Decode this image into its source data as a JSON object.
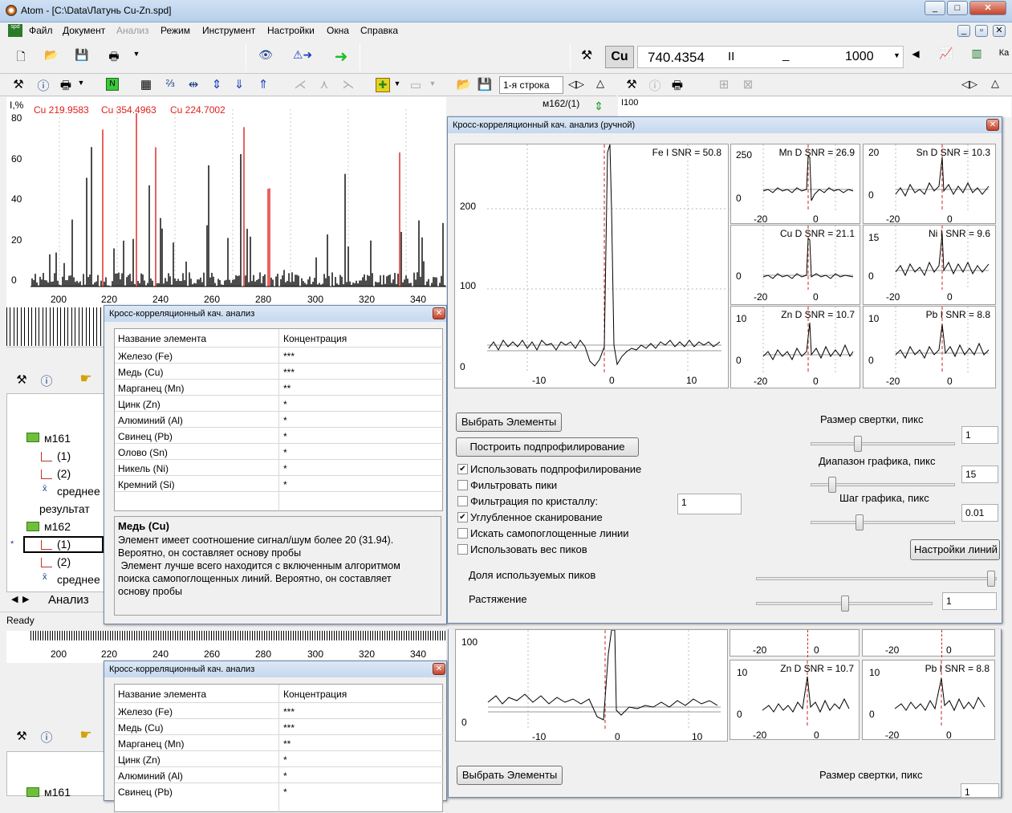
{
  "window": {
    "title": "Atom - [C:\\Data\\Латунь Cu-Zn.spd]"
  },
  "menu": [
    "Файл",
    "Документ",
    "Анализ",
    "Режим",
    "Инструмент",
    "Настройки",
    "Окна",
    "Справка"
  ],
  "top_toolbar": {
    "element": "Cu",
    "wavelength": "740.4354",
    "marker_a": "II",
    "marker_b": "_",
    "count": "1000"
  },
  "spectrum_toolbar": {
    "row_select": "1-я строка"
  },
  "spectrum": {
    "y_unit": "I,%",
    "peaks_labels": [
      "Cu 219.9583",
      "Cu 354.4963",
      "Cu 224.7002"
    ],
    "y_ticks": [
      "80",
      "60",
      "40",
      "20",
      "0"
    ],
    "x_ticks": [
      "200",
      "220",
      "240",
      "260",
      "280",
      "300",
      "320",
      "340"
    ],
    "file_tag": "м162/(1)"
  },
  "right_panel": {
    "tag": "I100"
  },
  "tree": {
    "items": [
      {
        "label": "м161",
        "kind": "folder"
      },
      {
        "label": "(1)",
        "kind": "chart"
      },
      {
        "label": "(2)",
        "kind": "chart"
      },
      {
        "label": "среднее",
        "kind": "avg"
      },
      {
        "label": "результат",
        "kind": "text"
      },
      {
        "label": "м162",
        "kind": "folder"
      },
      {
        "label": "(1)",
        "kind": "chart"
      },
      {
        "label": "(2)",
        "kind": "chart"
      },
      {
        "label": "среднее",
        "kind": "avg"
      }
    ],
    "current_marker": "*",
    "tab": "Анализ"
  },
  "status": "Ready",
  "dlg_small": {
    "title": "Кросс-корреляционный кач. анализ",
    "col_name": "Название элемента",
    "col_conc": "Концентрация",
    "rows": [
      [
        "Железо (Fe)",
        "***"
      ],
      [
        "Медь (Cu)",
        "***"
      ],
      [
        "Марганец (Mn)",
        "**"
      ],
      [
        "Цинк (Zn)",
        "*"
      ],
      [
        "Алюминий (Al)",
        "*"
      ],
      [
        "Свинец (Pb)",
        "*"
      ],
      [
        "Олово (Sn)",
        "*"
      ],
      [
        "Никель (Ni)",
        "*"
      ],
      [
        "Кремний (Si)",
        "*"
      ]
    ],
    "info_title": "Медь (Cu)",
    "info_lines": [
      "Элемент имеет соотношение сигнал/шум более 20 (31.94).",
      "Вероятно, он составляет основу пробы",
      " Элемент лучше всего находится с включенным алгоритмом",
      "поиска самопоглощенных линий. Вероятно, он составляет",
      "основу пробы"
    ]
  },
  "dlg_main": {
    "title": "Кросс-корреляционный кач. анализ (ручной)",
    "big_chart": {
      "label": "Fe I SNR = 50.8",
      "y_ticks": [
        "200",
        "100",
        "0"
      ],
      "x_ticks": [
        "-10",
        "0",
        "10"
      ]
    },
    "small_charts": [
      {
        "label": "Mn D SNR = 26.9",
        "ytop": "250",
        "y0": "0",
        "x": [
          "-20",
          "0"
        ]
      },
      {
        "label": "Sn D SNR = 10.3",
        "ytop": "20",
        "y0": "0",
        "x": [
          "-20",
          "0"
        ]
      },
      {
        "label": "Cu D SNR = 21.1",
        "ytop": "",
        "y0": "0",
        "x": [
          "-20",
          "0"
        ]
      },
      {
        "label": "Ni I SNR = 9.6",
        "ytop": "15",
        "y0": "0",
        "x": [
          "-20",
          "0"
        ]
      },
      {
        "label": "Zn D SNR = 10.7",
        "ytop": "10",
        "y0": "0",
        "x": [
          "-20",
          "0"
        ]
      },
      {
        "label": "Pb I SNR = 8.8",
        "ytop": "10",
        "y0": "0",
        "x": [
          "-20",
          "0"
        ]
      }
    ],
    "btn_select": "Выбрать Элементы",
    "btn_build": "Построить подпрофилирование",
    "checks": [
      {
        "label": "Использовать подпрофилирование",
        "checked": true
      },
      {
        "label": "Фильтровать пики",
        "checked": false
      },
      {
        "label": "Фильтрация по кристаллу:",
        "checked": false
      },
      {
        "label": "Углубленное сканирование",
        "checked": true
      },
      {
        "label": "Искать самопоглощенные линии",
        "checked": false
      },
      {
        "label": "Использовать вес пиков",
        "checked": false
      }
    ],
    "crystal_value": "1",
    "conv_label": "Размер  свертки, пикс",
    "conv_value": "1",
    "range_label": "Диапазон графика, пикс",
    "range_value": "15",
    "step_label": "Шаг графика, пикс",
    "step_value": "0.01",
    "btn_lines": "Настройки линий",
    "share_label": "Доля используемых пиков",
    "stretch_label": "Растяжение",
    "stretch_value": "1"
  },
  "ghost": {
    "x_ticks": [
      "200",
      "220",
      "240",
      "260",
      "280",
      "300",
      "320",
      "340"
    ],
    "chart_tick_100": "100",
    "zn_label": "Zn D SNR = 10.7",
    "pb_label": "Pb I SNR = 8.8",
    "tick_10": "10",
    "tick_0": "0",
    "tick_m20": "-20",
    "tick_m10": "-10",
    "tick_p10": "10",
    "btn_select": "Выбрать Элементы",
    "conv_label": "Размер  свертки, пикс",
    "conv_value": "1",
    "tree_item": "м161"
  }
}
